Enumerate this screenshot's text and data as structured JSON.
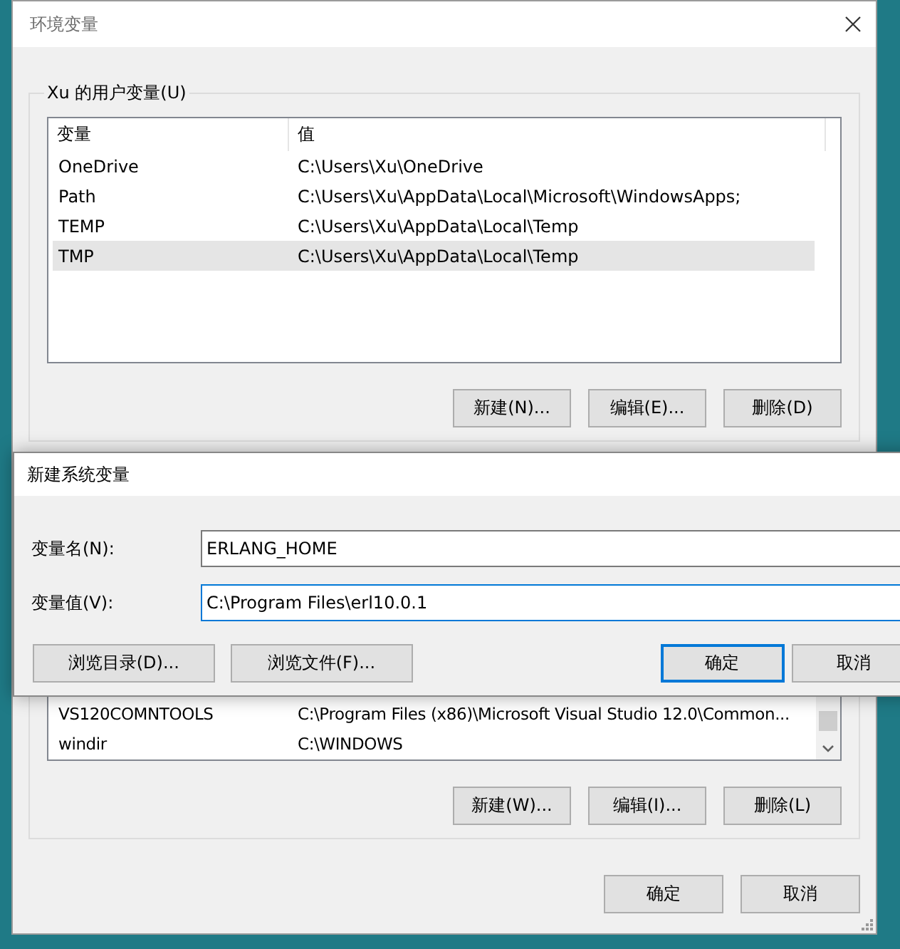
{
  "window": {
    "title": "环境变量"
  },
  "user_variables": {
    "label": "Xu 的用户变量(U)",
    "columns": [
      "变量",
      "值"
    ],
    "rows": [
      {
        "name": "OneDrive",
        "value": "C:\\Users\\Xu\\OneDrive",
        "selected": false
      },
      {
        "name": "Path",
        "value": "C:\\Users\\Xu\\AppData\\Local\\Microsoft\\WindowsApps;",
        "selected": false
      },
      {
        "name": "TEMP",
        "value": "C:\\Users\\Xu\\AppData\\Local\\Temp",
        "selected": false
      },
      {
        "name": "TMP",
        "value": "C:\\Users\\Xu\\AppData\\Local\\Temp",
        "selected": true
      }
    ],
    "buttons": [
      "新建(N)...",
      "编辑(E)...",
      "删除(D)"
    ]
  },
  "system_variables": {
    "rows": [
      {
        "name": "VS120COMNTOOLS",
        "value": "C:\\Program Files (x86)\\Microsoft Visual Studio 12.0\\Common...",
        "selected": false
      },
      {
        "name": "windir",
        "value": "C:\\WINDOWS",
        "selected": false
      }
    ],
    "buttons": [
      "新建(W)...",
      "编辑(I)...",
      "删除(L)"
    ]
  },
  "buttons": [
    "确定",
    "取消"
  ],
  "dialog": {
    "title": "新建系统变量",
    "fields": [
      {
        "label": "变量名(N):",
        "value": "ERLANG_HOME",
        "focused": false
      },
      {
        "label": "变量值(V):",
        "value": "C:\\Program Files\\erl10.0.1",
        "focused": true
      }
    ],
    "buttons": [
      {
        "label": "浏览目录(D)...",
        "default": false
      },
      {
        "label": "浏览文件(F)...",
        "default": false
      },
      {
        "label": "确定",
        "default": true
      },
      {
        "label": "取消",
        "default": false
      }
    ]
  }
}
